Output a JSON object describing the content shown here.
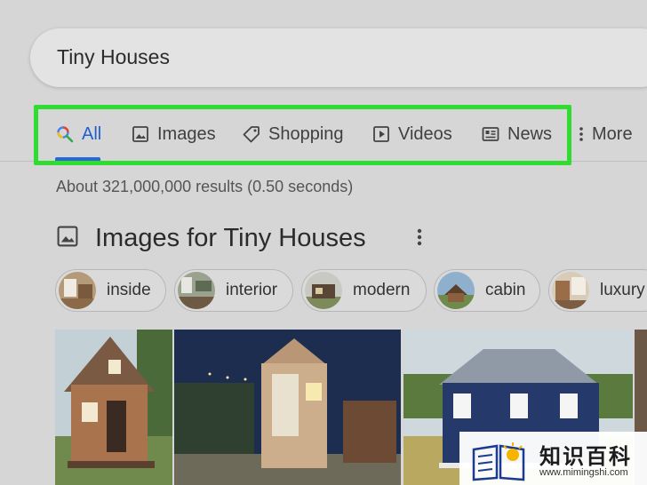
{
  "search": {
    "query": "Tiny Houses"
  },
  "tabs": [
    {
      "label": "All",
      "icon": "search-icon"
    },
    {
      "label": "Images",
      "icon": "image-icon"
    },
    {
      "label": "Shopping",
      "icon": "tag-icon"
    },
    {
      "label": "Videos",
      "icon": "play-icon"
    },
    {
      "label": "News",
      "icon": "news-icon"
    },
    {
      "label": "More",
      "icon": "more-vert-icon"
    }
  ],
  "results": {
    "count_text": "About 321,000,000 results (0.50 seconds)"
  },
  "images_section": {
    "title": "Images for Tiny Houses",
    "chips": [
      {
        "label": "inside"
      },
      {
        "label": "interior"
      },
      {
        "label": "modern"
      },
      {
        "label": "cabin"
      },
      {
        "label": "luxury"
      }
    ]
  },
  "watermark": {
    "text": "知识百科",
    "url": "www.mimingshi.com"
  },
  "colors": {
    "accent": "#1f5fcf",
    "highlight": "#2fdc2f",
    "background": "#d6d6d6"
  }
}
